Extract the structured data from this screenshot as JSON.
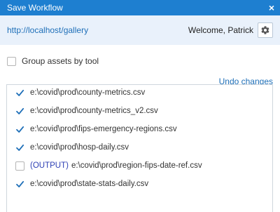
{
  "window": {
    "title": "Save Workflow",
    "close_glyph": "×"
  },
  "header": {
    "url": "http://localhost/gallery",
    "welcome": "Welcome, Patrick",
    "settings_icon": "gear-icon"
  },
  "options": {
    "group_assets_label": "Group assets by tool",
    "group_assets_checked": false,
    "undo_label": "Undo changes"
  },
  "assets": [
    {
      "path": "e:\\covid\\prod\\county-metrics.csv",
      "checked": true,
      "tag": ""
    },
    {
      "path": "e:\\covid\\prod\\county-metrics_v2.csv",
      "checked": true,
      "tag": ""
    },
    {
      "path": "e:\\covid\\prod\\fips-emergency-regions.csv",
      "checked": true,
      "tag": ""
    },
    {
      "path": "e:\\covid\\prod\\hosp-daily.csv",
      "checked": true,
      "tag": ""
    },
    {
      "path": "e:\\covid\\prod\\region-fips-date-ref.csv",
      "checked": false,
      "tag": "(OUTPUT)"
    },
    {
      "path": "e:\\covid\\prod\\state-stats-daily.csv",
      "checked": true,
      "tag": ""
    }
  ],
  "colors": {
    "titlebar": "#1e7fd0",
    "link": "#1e6fb8",
    "check": "#1e6fb8",
    "output_tag": "#2d3fb4"
  }
}
